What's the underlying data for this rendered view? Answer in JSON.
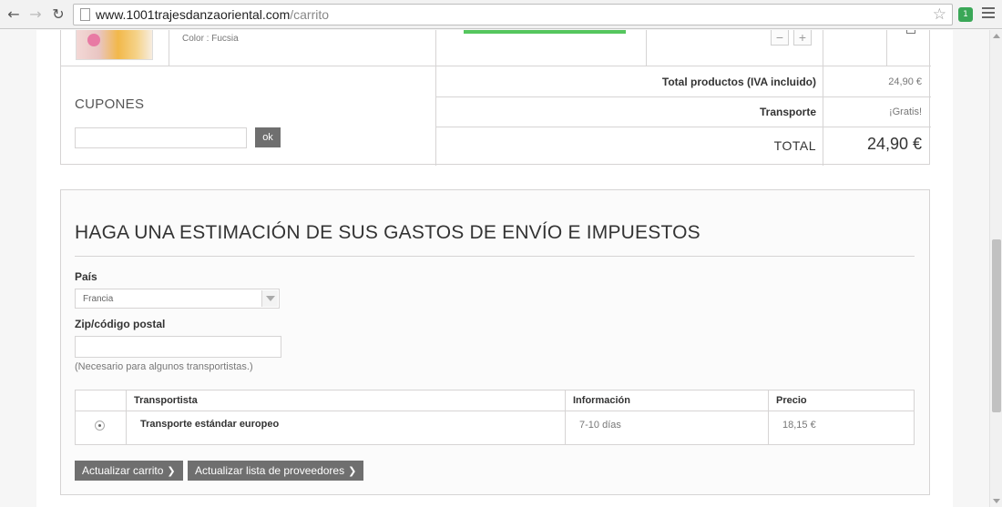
{
  "browser": {
    "back_icon": "back-arrow-icon",
    "forward_icon": "forward-arrow-icon",
    "reload_icon": "reload-icon",
    "url_host": "www.1001trajesdanzaoriental.com",
    "url_path": "/carrito",
    "bookmark_icon": "star-icon",
    "extension_badge": "1",
    "menu_icon": "hamburger-menu-icon"
  },
  "cart": {
    "product_color": "Color : Fucsia",
    "qty_minus": "−",
    "qty_plus": "+",
    "coupons_title": "CUPONES",
    "coupon_ok": "ok",
    "summary": {
      "total_products_label": "Total productos (IVA incluido)",
      "total_products_value": "24,90 €",
      "shipping_label": "Transporte",
      "shipping_value": "¡Gratis!",
      "total_label": "TOTAL",
      "total_value": "24,90 €"
    }
  },
  "estimate": {
    "title": "HAGA UNA ESTIMACIÓN DE SUS GASTOS DE ENVÍO E IMPUESTOS",
    "country_label": "País",
    "country_value": "Francia",
    "zip_label": "Zip/código postal",
    "zip_value": "",
    "zip_help": "(Necesario para algunos transportistas.)",
    "table": {
      "headers": [
        "Transportista",
        "Información",
        "Precio"
      ],
      "rows": [
        {
          "carrier": "Transporte estándar europeo",
          "info": "7-10 días",
          "price": "18,15 €"
        }
      ]
    },
    "update_cart_button": "Actualizar carrito",
    "update_carriers_button": "Actualizar lista de proveedores"
  },
  "colors": {
    "button_gray": "#6f6f6f",
    "border": "#d6d4d4",
    "green_accent": "#55c65e"
  }
}
